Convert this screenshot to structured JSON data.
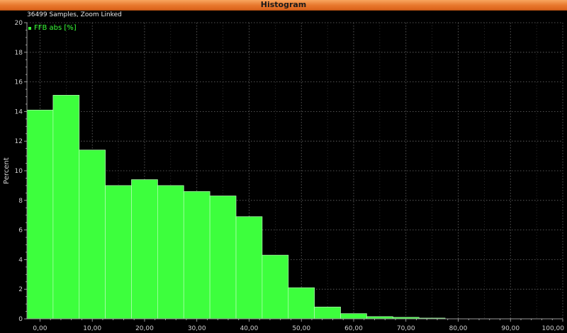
{
  "window": {
    "title": "Histogram",
    "subtitle": "36499 Samples, Zoom Linked"
  },
  "colors": {
    "titlebar": "#e8772c",
    "background": "#000000",
    "bar_fill": "#3dff3d",
    "bar_stroke": "#b8ffb8",
    "grid": "#6a6a6a",
    "axis_text": "#cfcfcf",
    "legend_text": "#39ff39"
  },
  "chart_data": {
    "type": "bar",
    "title": "",
    "xlabel": "",
    "ylabel": "Percent",
    "series": [
      {
        "name": "FFB abs [%]",
        "bins": [
          {
            "x0": -2.5,
            "x1": 2.5,
            "value": 14.1
          },
          {
            "x0": 2.5,
            "x1": 7.5,
            "value": 15.1
          },
          {
            "x0": 7.5,
            "x1": 12.5,
            "value": 11.4
          },
          {
            "x0": 12.5,
            "x1": 17.5,
            "value": 9.0
          },
          {
            "x0": 17.5,
            "x1": 22.5,
            "value": 9.4
          },
          {
            "x0": 22.5,
            "x1": 27.5,
            "value": 9.0
          },
          {
            "x0": 27.5,
            "x1": 32.5,
            "value": 8.6
          },
          {
            "x0": 32.5,
            "x1": 37.5,
            "value": 8.3
          },
          {
            "x0": 37.5,
            "x1": 42.5,
            "value": 6.9
          },
          {
            "x0": 42.5,
            "x1": 47.5,
            "value": 4.3
          },
          {
            "x0": 47.5,
            "x1": 52.5,
            "value": 2.1
          },
          {
            "x0": 52.5,
            "x1": 57.5,
            "value": 0.8
          },
          {
            "x0": 57.5,
            "x1": 62.5,
            "value": 0.35
          },
          {
            "x0": 62.5,
            "x1": 67.5,
            "value": 0.15
          },
          {
            "x0": 67.5,
            "x1": 72.5,
            "value": 0.1
          },
          {
            "x0": 72.5,
            "x1": 77.5,
            "value": 0.05
          }
        ]
      }
    ],
    "xlim": [
      -2.5,
      100
    ],
    "ylim": [
      0,
      20
    ],
    "x_ticks": [
      0,
      10,
      20,
      30,
      40,
      50,
      60,
      70,
      80,
      90,
      100
    ],
    "x_tick_labels": [
      "0,00",
      "10,00",
      "20,00",
      "30,00",
      "40,00",
      "50,00",
      "60,00",
      "70,00",
      "80,00",
      "90,00",
      "100,00"
    ],
    "y_ticks": [
      0,
      2,
      4,
      6,
      8,
      10,
      12,
      14,
      16,
      18,
      20
    ],
    "y_tick_labels": [
      "0",
      "2",
      "4",
      "6",
      "8",
      "10",
      "12",
      "14",
      "16",
      "18",
      "20"
    ],
    "grid": true,
    "legend_position": "top-left"
  }
}
